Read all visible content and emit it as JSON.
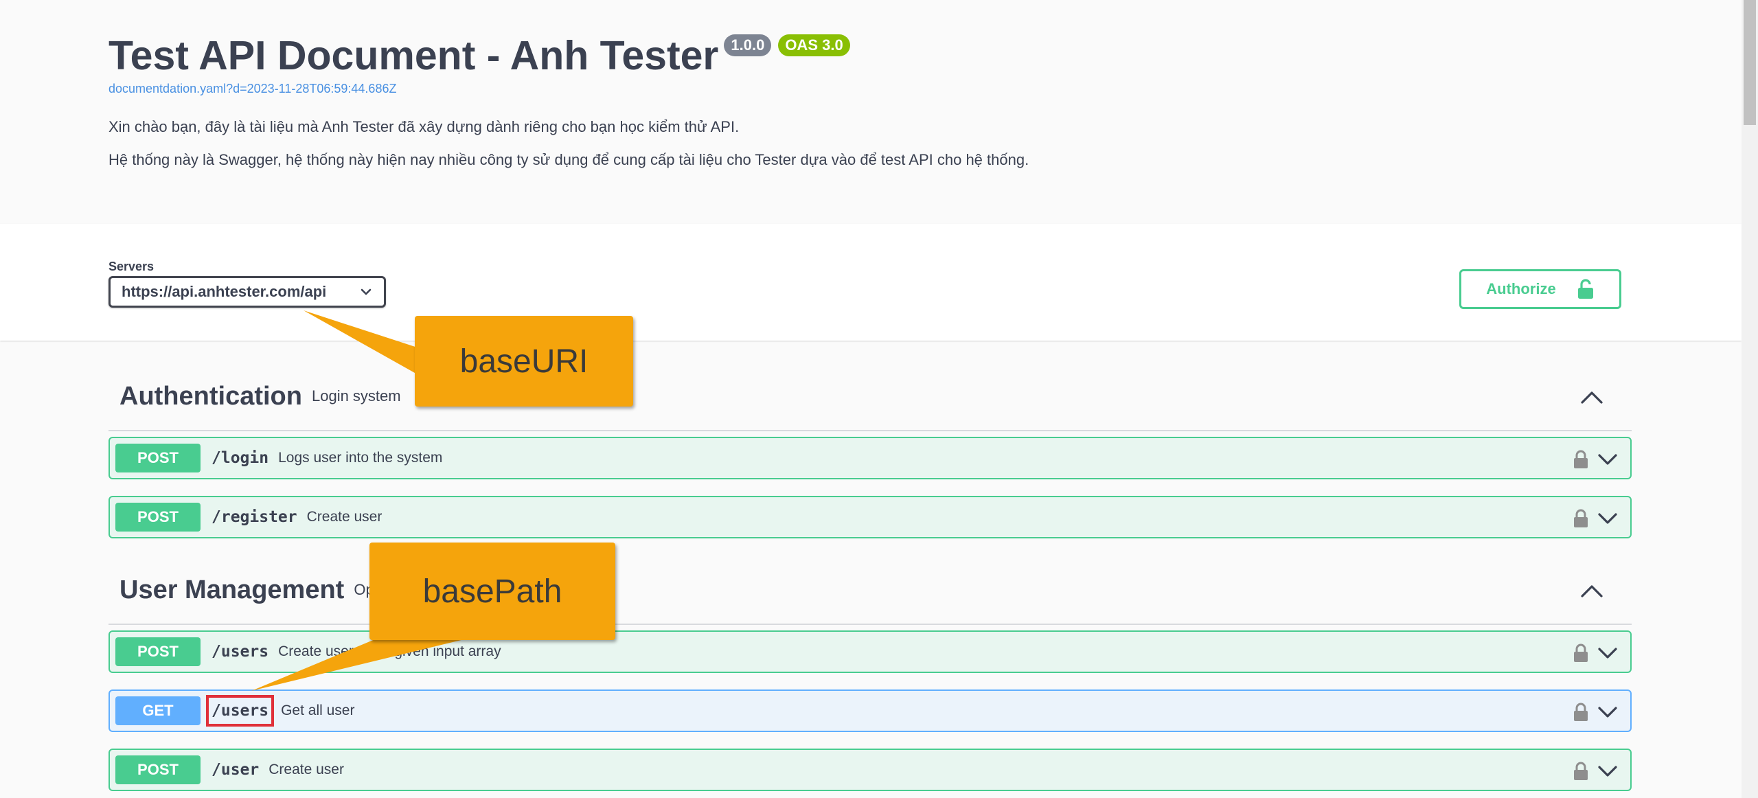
{
  "info": {
    "title": "Test API Document - Anh Tester",
    "version_badge": "1.0.0",
    "oas_badge": "OAS 3.0",
    "spec_link": "documentdation.yaml?d=2023-11-28T06:59:44.686Z",
    "description_line1": "Xin chào bạn, đây là tài liệu mà Anh Tester đã xây dựng dành riêng cho bạn học kiểm thử API.",
    "description_line2": "Hệ thống này là Swagger, hệ thống này hiện nay nhiều công ty sử dụng để cung cấp tài liệu cho Tester dựa vào để test API cho hệ thống."
  },
  "servers": {
    "label": "Servers",
    "selected": "https://api.anhtester.com/api",
    "authorize_label": "Authorize"
  },
  "tags": [
    {
      "name": "Authentication",
      "description": "Login system"
    },
    {
      "name": "User Management",
      "description": "Op"
    }
  ],
  "operations": [
    {
      "method": "POST",
      "path": "/login",
      "summary": "Logs user into the system"
    },
    {
      "method": "POST",
      "path": "/register",
      "summary": "Create user"
    },
    {
      "method": "POST",
      "path": "/users",
      "summary": "Create   users with given input array"
    },
    {
      "method": "GET",
      "path": "/users",
      "summary": "Get all user"
    },
    {
      "method": "POST",
      "path": "/user",
      "summary": "Create user"
    }
  ],
  "annotations": {
    "base_uri": "baseURI",
    "base_path": "basePath"
  },
  "colors": {
    "post": "#49cc90",
    "get": "#61affe",
    "callout": "#f5a40c",
    "highlight_box": "#e0303a"
  },
  "icons": {
    "tag_toggle": "chevron-up-icon",
    "op_lock": "lock-icon",
    "op_expand": "chevron-down-icon",
    "authorize": "unlock-icon"
  }
}
